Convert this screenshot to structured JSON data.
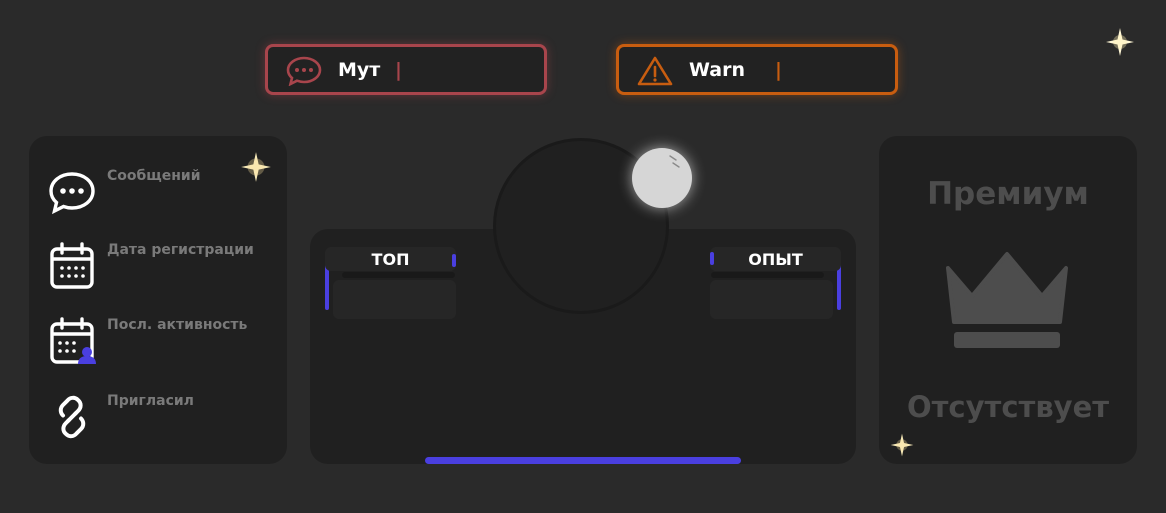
{
  "status": {
    "mute": {
      "label": "Мут",
      "value": "|",
      "color": "#a8454c",
      "icon": "chat-bubble-icon"
    },
    "warn": {
      "label": "Warn",
      "value": "|",
      "color": "#c85d10",
      "icon": "warning-triangle-icon"
    }
  },
  "info": {
    "items": [
      {
        "label": "Сообщений",
        "icon": "chat-bubble-icon"
      },
      {
        "label": "Дата регистрации",
        "icon": "calendar-icon"
      },
      {
        "label": "Посл. активность",
        "icon": "calendar-user-icon"
      },
      {
        "label": "Пригласил",
        "icon": "link-icon"
      }
    ]
  },
  "profile": {
    "top_label": "ТОП",
    "xp_label": "ОПЫТ",
    "accent_color": "#4a3fe0",
    "online_indicator": "status-orb"
  },
  "premium": {
    "title": "Премиум",
    "status": "Отсутствует",
    "icon": "crown-icon"
  }
}
